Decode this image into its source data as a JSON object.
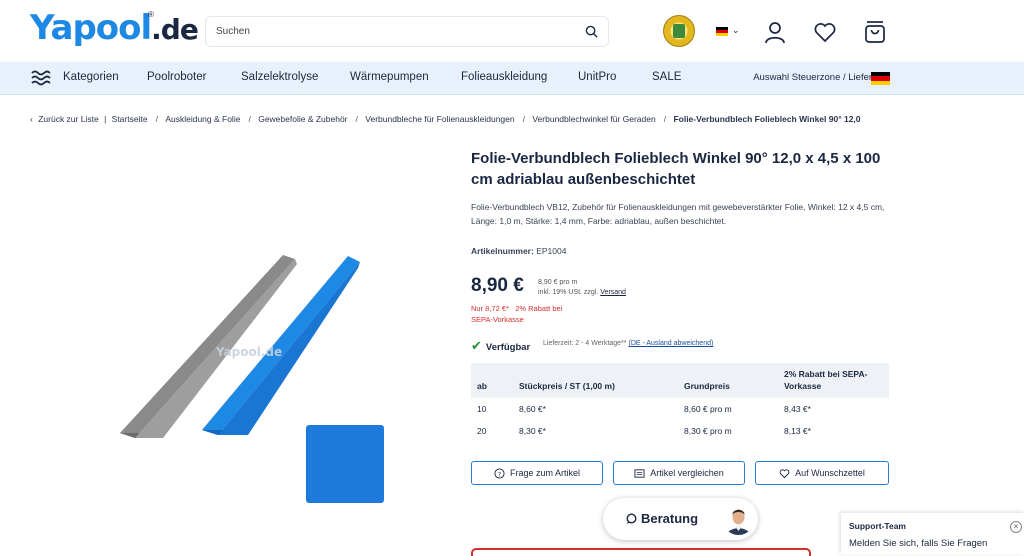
{
  "header": {
    "logo_text": "Yapool",
    "logo_domain": ".de",
    "logo_reg": "®",
    "search_placeholder": "Suchen"
  },
  "nav": {
    "items": [
      "Kategorien",
      "Poolroboter",
      "Salzelektrolyse",
      "Wärmepumpen",
      "Folieauskleidung",
      "UnitPro",
      "SALE"
    ],
    "right_label": "Auswahl Steuerzone / Lieferland"
  },
  "breadcrumb": {
    "back": "Zurück zur Liste",
    "items": [
      "Startseite",
      "Auskleidung & Folie",
      "Gewebefolie & Zubehör",
      "Verbundbleche für Folienauskleidungen",
      "Verbundblechwinkel für Geraden",
      "Folie-Verbundblech Folieblech Winkel 90° 12,0"
    ]
  },
  "product": {
    "title": "Folie-Verbundblech Folieblech Winkel 90° 12,0 x 4,5 x 100 cm adriablau außenbeschichtet",
    "description": "Folie-Verbundblech VB12, Zubehör für Folienauskleidungen mit gewebeverstärkter Folie, Winkel: 12 x 4,5 cm, Länge: 1,0 m, Stärke: 1,4 mm, Farbe: adriablau, außen beschichtet.",
    "artnr_label": "Artikelnummer:",
    "artnr_value": "EP1004",
    "price": "8,90 €",
    "price_unit": "8,90 € pro m",
    "price_tax": "inkl. 19% USt. zzgl.",
    "price_shipping": "Versand",
    "sepa_price": "Nur 8,72 €*",
    "sepa_discount": "2% Rabatt bei",
    "sepa_method": "SEPA-Vorkasse",
    "availability": "Verfügbar",
    "delivery_time": "Lieferzeit: 2 - 4 Werktage**",
    "delivery_link": "(DE - Ausland abweichend)"
  },
  "tiers": {
    "headers": [
      "ab",
      "Stückpreis / ST (1,00 m)",
      "Grundpreis",
      "2% Rabatt bei SEPA-Vorkasse"
    ],
    "rows": [
      [
        "10",
        "8,60 €*",
        "8,60 € pro m",
        "8,43 €*"
      ],
      [
        "20",
        "8,30 €*",
        "8,30 € pro m",
        "8,13 €*"
      ]
    ]
  },
  "actions": {
    "question": "Frage zum Artikel",
    "compare": "Artikel vergleichen",
    "wishlist": "Auf Wunschzettel"
  },
  "beratung": {
    "label": "Beratung"
  },
  "support": {
    "title": "Support-Team",
    "text": "Melden Sie sich, falls Sie Fragen"
  },
  "colors": {
    "brand_blue": "#1e88e5",
    "nav_bg": "#e8f1fb",
    "price_red": "#d32f2f",
    "available_green": "#2e8b3e",
    "product_blue": "#1e7bdb"
  }
}
